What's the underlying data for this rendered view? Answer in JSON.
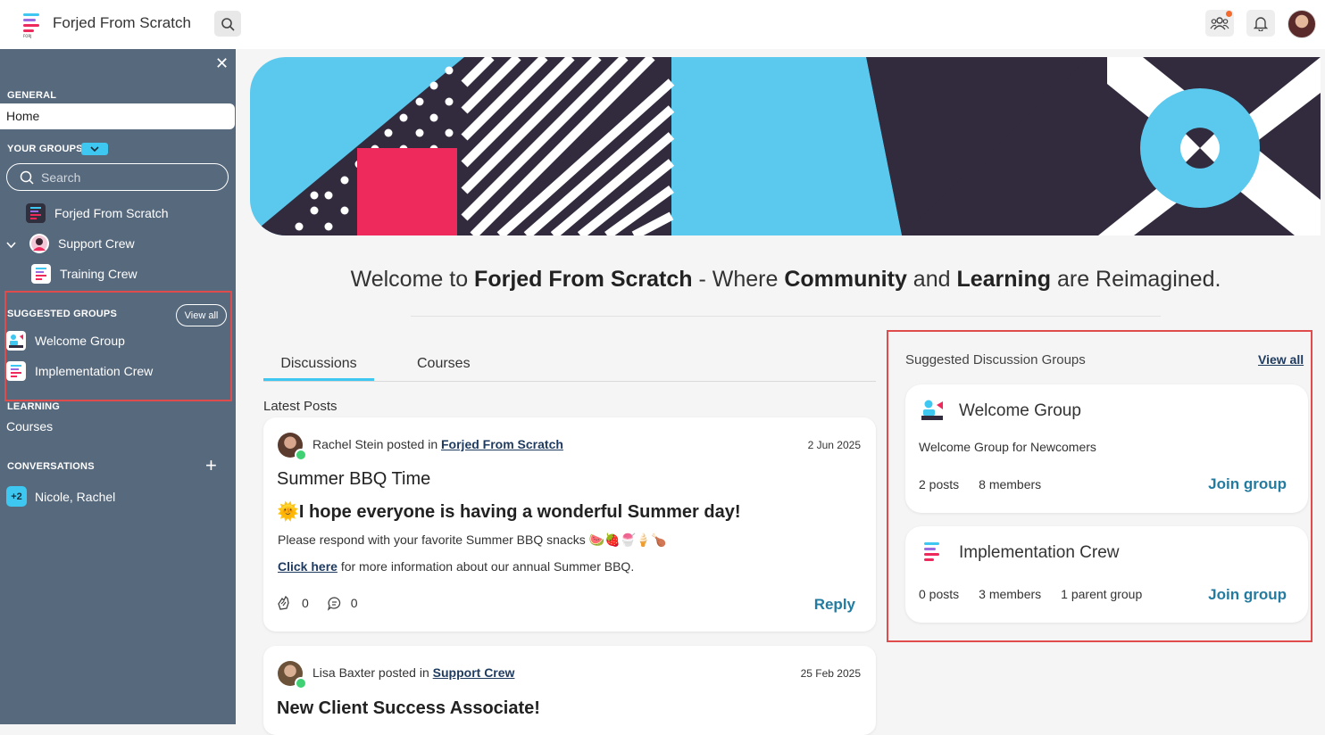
{
  "app": {
    "title": "Forjed From Scratch"
  },
  "topbar": {
    "search_icon": "search-icon",
    "community_icon": "people-icon",
    "bell_icon": "bell-icon"
  },
  "sidebar": {
    "general_heading": "GENERAL",
    "home": "Home",
    "your_groups_heading": "YOUR GROUPS",
    "search_placeholder": "Search",
    "groups": [
      {
        "label": "Forjed From Scratch"
      },
      {
        "label": "Support Crew"
      },
      {
        "label": "Training Crew"
      }
    ],
    "suggested_heading": "SUGGESTED GROUPS",
    "view_all": "View all",
    "suggested": [
      {
        "label": "Welcome Group"
      },
      {
        "label": "Implementation Crew"
      }
    ],
    "learning_heading": "LEARNING",
    "courses": "Courses",
    "conversations_heading": "CONVERSATIONS",
    "conversation": {
      "badge": "+2",
      "label": "Nicole, Rachel"
    }
  },
  "main": {
    "welcome": {
      "part1": "Welcome to ",
      "bold1": "Forjed From Scratch",
      "part2": " - Where ",
      "bold2": "Community",
      "part3": " and ",
      "bold3": "Learning",
      "part4": " are Reimagined."
    },
    "tabs": [
      {
        "label": "Discussions"
      },
      {
        "label": "Courses"
      }
    ],
    "latest_label": "Latest Posts",
    "posts": [
      {
        "author": "Rachel Stein",
        "posted_in": " posted in ",
        "group": "Forjed From Scratch",
        "date": "2 Jun 2025",
        "title": "Summer BBQ Time",
        "heading": "🌞I hope everyone is having a wonderful Summer day!",
        "body": "Please respond with your favorite Summer BBQ snacks 🍉🍓🍧🍦🍗",
        "link_text": "Click here",
        "link_rest": " for more information about our annual Summer BBQ.",
        "likes": "0",
        "comments": "0",
        "reply": "Reply"
      },
      {
        "author": "Lisa Baxter",
        "posted_in": " posted in ",
        "group": "Support Crew",
        "date": "25 Feb 2025",
        "title": "New Client Success Associate!"
      }
    ]
  },
  "right": {
    "title": "Suggested Discussion Groups",
    "view_all": "View all",
    "groups": [
      {
        "name": "Welcome Group",
        "desc": "Welcome Group for Newcomers",
        "posts": "2 posts",
        "members": "8 members",
        "join": "Join group"
      },
      {
        "name": "Implementation Crew",
        "posts": "0 posts",
        "members": "3 members",
        "parents": "1 parent group",
        "join": "Join group"
      }
    ]
  },
  "colors": {
    "sidebar": "#57697d",
    "accent": "#3ec7f0",
    "brand_pink": "#ee2a5d",
    "dark": "#322a3d",
    "highlight_border": "#e04b4b",
    "link": "#247ba0"
  }
}
